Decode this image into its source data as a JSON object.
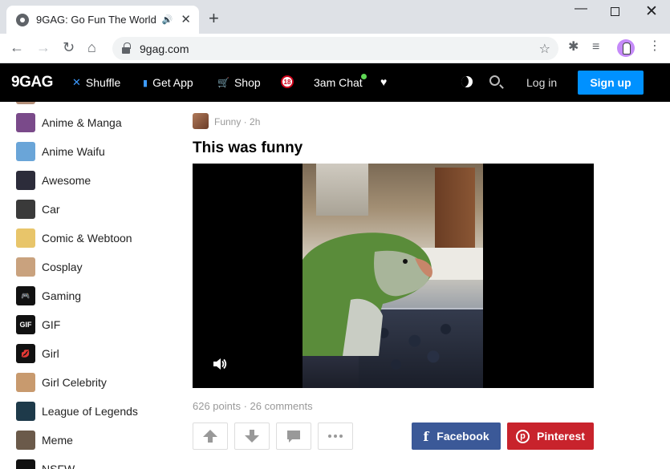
{
  "browser": {
    "tab_title": "9GAG: Go Fun The World",
    "tab_audio": "🔊",
    "tab_close": "✕",
    "new_tab": "+",
    "url": "9gag.com",
    "win_min": "—",
    "win_close": "✕",
    "back": "←",
    "forward": "→",
    "reload": "↻",
    "home": "⌂",
    "star": "☆",
    "puzzle": "✱",
    "media": "≡",
    "menu": "⋮"
  },
  "header": {
    "logo": "9GAG",
    "nav": [
      {
        "icon": "✕",
        "label": "Shuffle"
      },
      {
        "icon": "▮",
        "label": "Get App"
      },
      {
        "icon": "🛒",
        "label": "Shop"
      },
      {
        "icon": "",
        "label": "18"
      },
      {
        "icon": "",
        "label": "3am Chat"
      },
      {
        "icon": "♥",
        "label": ""
      }
    ],
    "login": "Log in",
    "signup": "Sign up"
  },
  "sidebar": {
    "items": [
      {
        "label": "Anime & Manga",
        "color": "#7a4a8a",
        "glyph": ""
      },
      {
        "label": "Anime Waifu",
        "color": "#6aa5d8",
        "glyph": ""
      },
      {
        "label": "Awesome",
        "color": "#2c2c3a",
        "glyph": ""
      },
      {
        "label": "Car",
        "color": "#3a3a3a",
        "glyph": ""
      },
      {
        "label": "Comic & Webtoon",
        "color": "#e8c56a",
        "glyph": ""
      },
      {
        "label": "Cosplay",
        "color": "#c9a27e",
        "glyph": ""
      },
      {
        "label": "Gaming",
        "color": "#111111",
        "glyph": "🎮"
      },
      {
        "label": "GIF",
        "color": "#111111",
        "glyph": "GIF"
      },
      {
        "label": "Girl",
        "color": "#111111",
        "glyph": "💋"
      },
      {
        "label": "Girl Celebrity",
        "color": "#c89a6e",
        "glyph": ""
      },
      {
        "label": "League of Legends",
        "color": "#1e3a4a",
        "glyph": ""
      },
      {
        "label": "Meme",
        "color": "#6b5a4a",
        "glyph": ""
      },
      {
        "label": "NSFW",
        "color": "#111111",
        "glyph": ""
      }
    ]
  },
  "post": {
    "section": "Funny · 2h",
    "title": "This was funny",
    "stats": "626 points · 26 comments",
    "share_facebook": "Facebook",
    "share_pinterest": "Pinterest",
    "facebook_color": "#3b5998",
    "pinterest_color": "#c8232c"
  }
}
